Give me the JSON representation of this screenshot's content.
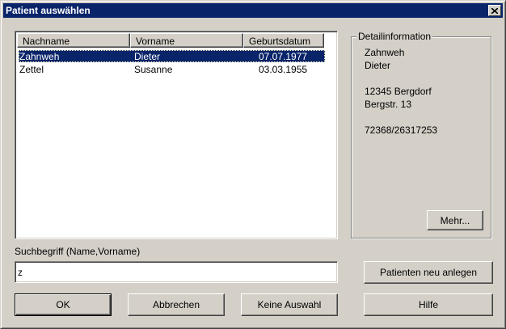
{
  "window": {
    "title": "Patient auswählen",
    "close_icon": "close-icon"
  },
  "patient_list": {
    "columns": [
      "Nachname",
      "Vorname",
      "Geburtsdatum"
    ],
    "rows": [
      {
        "nachname": "Zahnweh",
        "vorname": "Dieter",
        "geburtsdatum": "07.07.1977",
        "selected": true
      },
      {
        "nachname": "Zettel",
        "vorname": "Susanne",
        "geburtsdatum": "03.03.1955",
        "selected": false
      }
    ]
  },
  "detail": {
    "legend": "Detailinformation",
    "nachname": "Zahnweh",
    "vorname": "Dieter",
    "ort": "12345 Bergdorf",
    "strasse": "Bergstr. 13",
    "telefon": "72368/26317253",
    "mehr_label": "Mehr..."
  },
  "search": {
    "label": "Suchbegriff (Name,Vorname)",
    "value": "z"
  },
  "buttons": {
    "neu_anlegen": "Patienten neu anlegen",
    "ok": "OK",
    "abbrechen": "Abbrechen",
    "keine_auswahl": "Keine Auswahl",
    "hilfe": "Hilfe"
  },
  "colors": {
    "title_bar": "#0a246a",
    "face": "#d4d0c8",
    "selection": "#0a246a"
  }
}
